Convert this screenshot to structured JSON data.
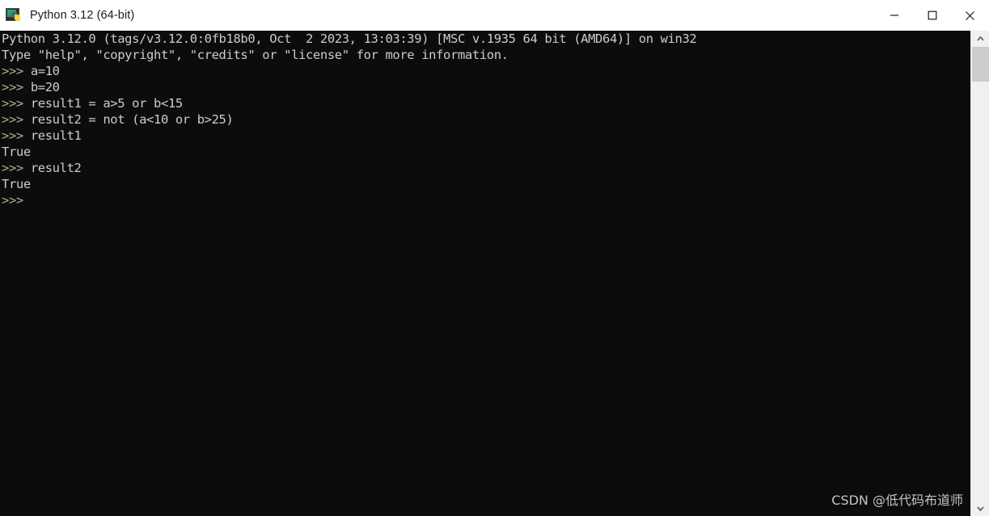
{
  "window": {
    "title": "Python 3.12 (64-bit)",
    "app_icon": "python-console-icon",
    "controls": {
      "minimize_label": "Minimize",
      "maximize_label": "Maximize",
      "close_label": "Close"
    }
  },
  "console": {
    "background_color": "#0c0c0c",
    "text_color": "#ccccd0",
    "prompt_color": "#b8a88a",
    "prompt": ">>>",
    "lines": [
      {
        "type": "output",
        "text": "Python 3.12.0 (tags/v3.12.0:0fb18b0, Oct  2 2023, 13:03:39) [MSC v.1935 64 bit (AMD64)] on win32"
      },
      {
        "type": "output",
        "text": "Type \"help\", \"copyright\", \"credits\" or \"license\" for more information."
      },
      {
        "type": "input",
        "text": "a=10"
      },
      {
        "type": "input",
        "text": "b=20"
      },
      {
        "type": "input",
        "text": "result1 = a>5 or b<15"
      },
      {
        "type": "input",
        "text": "result2 = not (a<10 or b>25)"
      },
      {
        "type": "input",
        "text": "result1"
      },
      {
        "type": "output",
        "text": "True"
      },
      {
        "type": "input",
        "text": "result2"
      },
      {
        "type": "output",
        "text": "True"
      },
      {
        "type": "input",
        "text": ""
      }
    ]
  },
  "watermark": {
    "text": "CSDN @低代码布道师"
  },
  "scrollbar": {
    "up_arrow_icon": "chevron-up-icon",
    "down_arrow_icon": "chevron-down-icon",
    "thumb_label": "scrollbar-thumb"
  }
}
